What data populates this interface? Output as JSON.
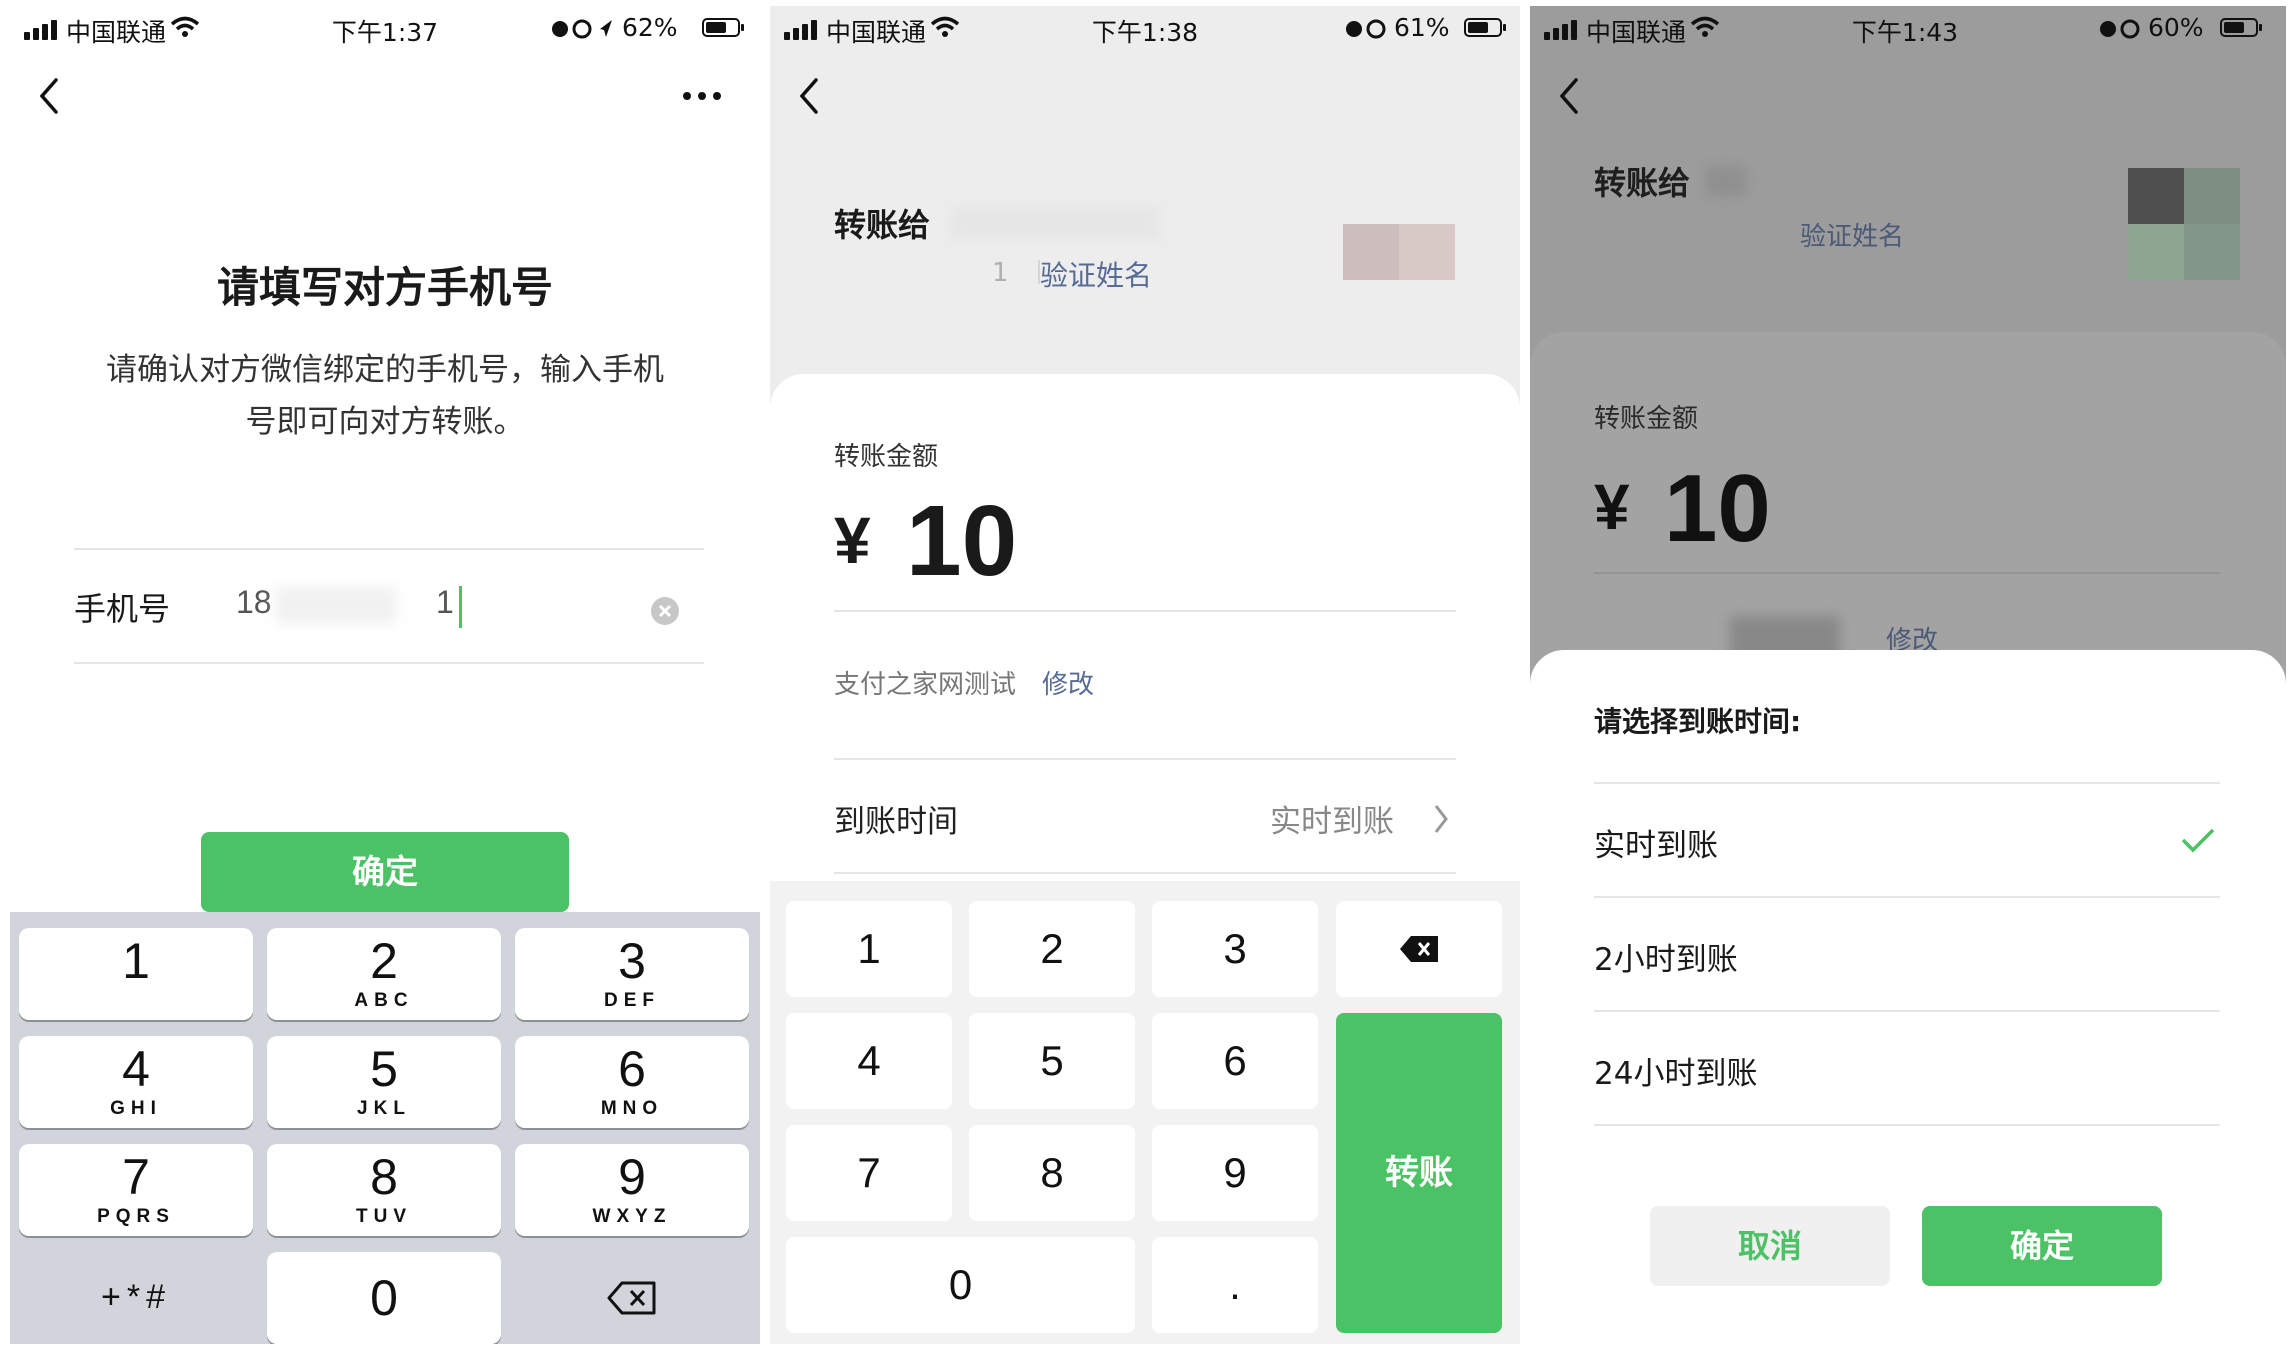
{
  "panel1": {
    "status": {
      "carrier": "中国联通",
      "time": "下午1:37",
      "battery": "62%"
    },
    "title": "请填写对方手机号",
    "description_line1": "请确认对方微信绑定的手机号，输入手机",
    "description_line2": "号即可向对方转账。",
    "phone_label": "手机号",
    "phone_value_start": "18",
    "phone_value_end": "1",
    "confirm": "确定",
    "keys": [
      {
        "d": "1",
        "l": ""
      },
      {
        "d": "2",
        "l": "ABC"
      },
      {
        "d": "3",
        "l": "DEF"
      },
      {
        "d": "4",
        "l": "GHI"
      },
      {
        "d": "5",
        "l": "JKL"
      },
      {
        "d": "6",
        "l": "MNO"
      },
      {
        "d": "7",
        "l": "PQRS"
      },
      {
        "d": "8",
        "l": "TUV"
      },
      {
        "d": "9",
        "l": "WXYZ"
      },
      {
        "d": "+*#",
        "l": ""
      },
      {
        "d": "0",
        "l": ""
      }
    ]
  },
  "panel2": {
    "status": {
      "carrier": "中国联通",
      "time": "下午1:38",
      "battery": "61%"
    },
    "transfer_to": "转账给",
    "phone_hint": "1",
    "verify_name": "验证姓名",
    "amount_label": "转账金额",
    "currency": "¥",
    "amount": "10",
    "note": "支付之家网测试",
    "edit": "修改",
    "arrival_label": "到账时间",
    "arrival_value": "实时到账",
    "keys": [
      "1",
      "2",
      "3",
      "4",
      "5",
      "6",
      "7",
      "8",
      "9",
      "0",
      "."
    ],
    "transfer_button": "转账"
  },
  "panel3": {
    "status": {
      "carrier": "中国联通",
      "time": "下午1:43",
      "battery": "60%"
    },
    "transfer_to": "转账给",
    "verify_name": "验证姓名",
    "amount_label": "转账金额",
    "currency": "¥",
    "amount": "10",
    "edit": "修改",
    "sheet_title": "请选择到账时间:",
    "options": [
      "实时到账",
      "2小时到账",
      "24小时到账"
    ],
    "selected_option": "实时到账",
    "cancel": "取消",
    "confirm": "确定"
  },
  "colors": {
    "accent": "#4cc266",
    "link": "#576b95"
  }
}
